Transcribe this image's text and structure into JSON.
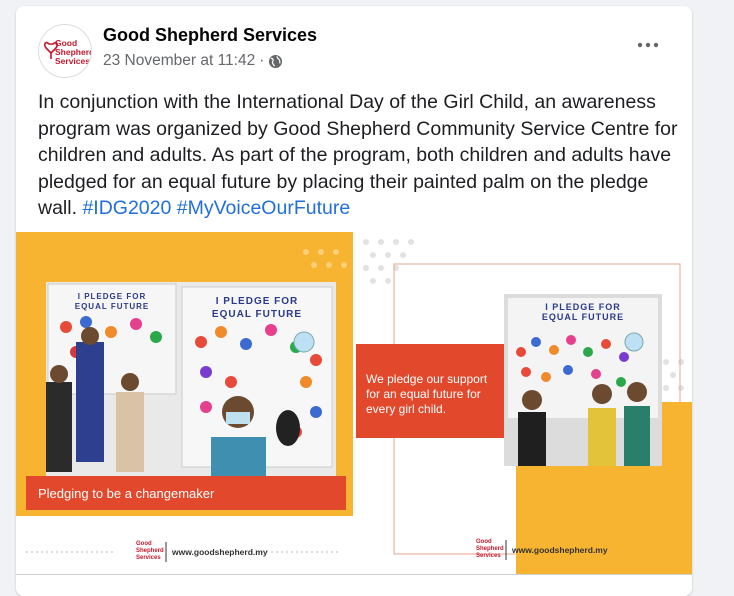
{
  "post": {
    "page_name": "Good Shepherd Services",
    "timestamp": "23 November at 11:42",
    "separator": "·",
    "audience_icon": "globe-icon",
    "more_icon": "more-options-icon",
    "text": "In conjunction with the International Day of the Girl Child, an awareness program was organized by Good Shepherd Community Service Centre for children and adults. As part of the program, both children and adults have pledged for an equal future by placing their painted palm on the pledge wall.",
    "hashtags": [
      "#IDG2020",
      "#MyVoiceOurFuture"
    ]
  },
  "avatar_logo": {
    "line1": "Good",
    "line2": "Shepherd",
    "line3": "Services"
  },
  "photos": {
    "left": {
      "board_title_1": "I PLEDGE FOR",
      "board_title_2": "EQUAL FUTURE",
      "board_title_3": "I PLEDGE FOR",
      "board_title_4": "EQUAL FUTURE",
      "caption": "Pledging to be a changemaker",
      "footer_logo_1": "Good",
      "footer_logo_2": "Shepherd",
      "footer_logo_3": "Services",
      "footer_url": "www.goodshepherd.my"
    },
    "right": {
      "board_title_1": "I PLEDGE FOR",
      "board_title_2": "EQUAL FUTURE",
      "caption": "We pledge our support for an equal future for every girl child.",
      "footer_logo_1": "Good",
      "footer_logo_2": "Shepherd",
      "footer_logo_3": "Services",
      "footer_url": "www.goodshepherd.my"
    }
  },
  "colors": {
    "brand_red": "#c4172b",
    "hashtag_blue": "#216fdb",
    "photo_orange": "#f6b431",
    "caption_red": "#e2482b"
  }
}
